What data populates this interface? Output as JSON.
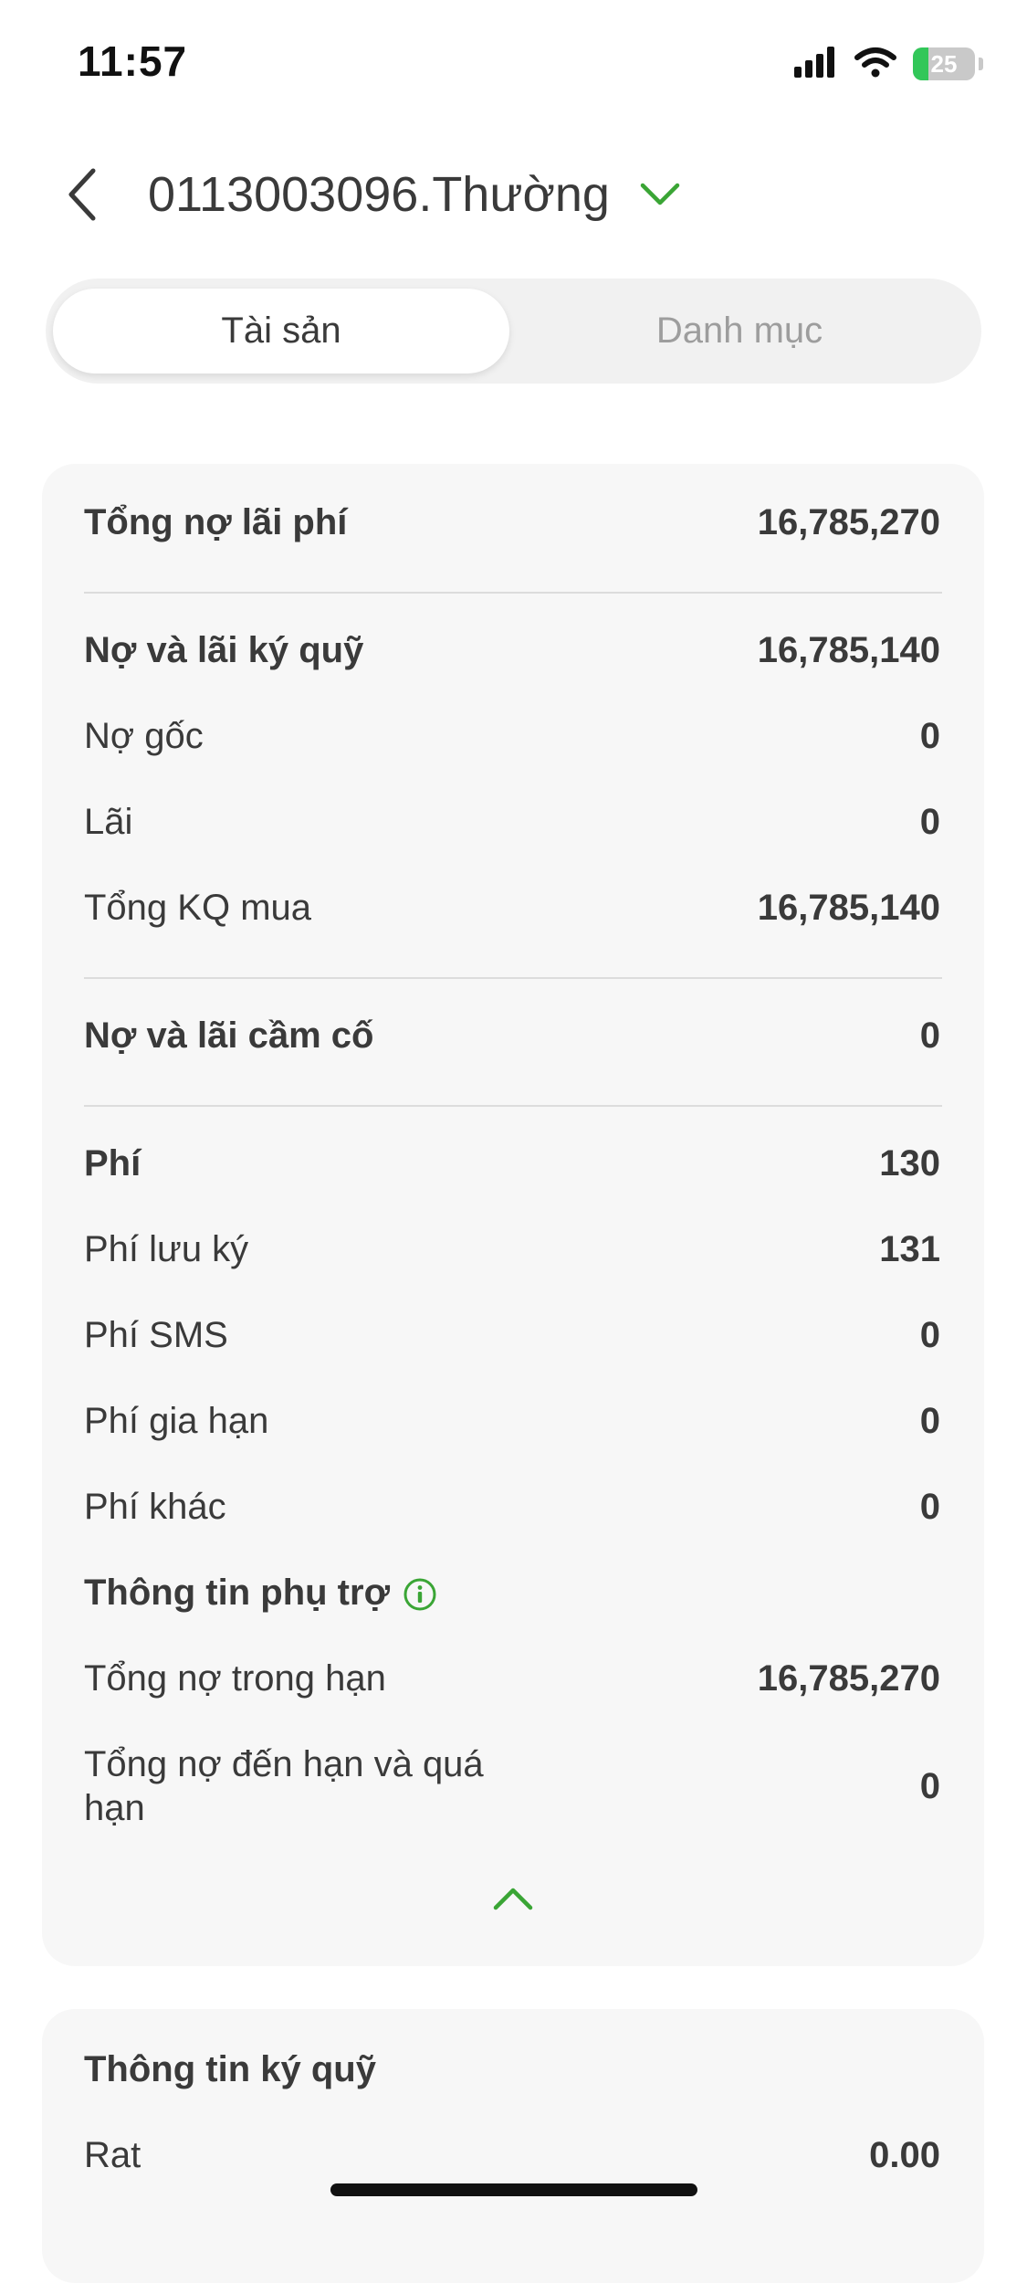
{
  "status_bar": {
    "time": "11:57",
    "battery_level": "25",
    "icons": [
      "signal-icon",
      "wifi-icon",
      "battery-charging-icon"
    ]
  },
  "header": {
    "account_label": "0113003096.Thường",
    "icons": [
      "chevron-left-icon",
      "chevron-down-icon"
    ]
  },
  "tabs": [
    {
      "label": "Tài sản",
      "active": true
    },
    {
      "label": "Danh mục",
      "active": false
    }
  ],
  "debt_card": {
    "total": {
      "label": "Tổng nợ lãi phí",
      "value": "16,785,270"
    },
    "margin_debt": {
      "label": "Nợ và lãi ký quỹ",
      "value": "16,785,140"
    },
    "principal": {
      "label": "Nợ gốc",
      "value": "0"
    },
    "interest": {
      "label": "Lãi",
      "value": "0"
    },
    "total_purchase": {
      "label": "Tổng KQ mua",
      "value": "16,785,140"
    },
    "pledge_debt": {
      "label": "Nợ và lãi cầm cố",
      "value": "0"
    },
    "fees": {
      "label": "Phí",
      "value": "130"
    },
    "custody_fee": {
      "label": "Phí lưu ký",
      "value": "131"
    },
    "sms_fee": {
      "label": "Phí SMS",
      "value": "0"
    },
    "extension_fee": {
      "label": "Phí gia hạn",
      "value": "0"
    },
    "other_fee": {
      "label": "Phí khác",
      "value": "0"
    },
    "support_info": {
      "label": "Thông tin phụ trợ"
    },
    "debt_in_term": {
      "label": "Tổng nợ trong hạn",
      "value": "16,785,270"
    },
    "debt_due_overdue": {
      "label_line1": "Tổng nợ đến hạn và quá",
      "label_line2": "hạn",
      "value": "0"
    }
  },
  "margin_card": {
    "title": "Thông tin ký quỹ",
    "rat": {
      "label": "Rat",
      "value": "0.00"
    }
  },
  "colors": {
    "accent_green": "#3aa535",
    "card_bg": "#f7f7f7",
    "segment_bg": "#f1f1f1",
    "text": "#3a3a3a",
    "muted": "#9d9d9d"
  }
}
